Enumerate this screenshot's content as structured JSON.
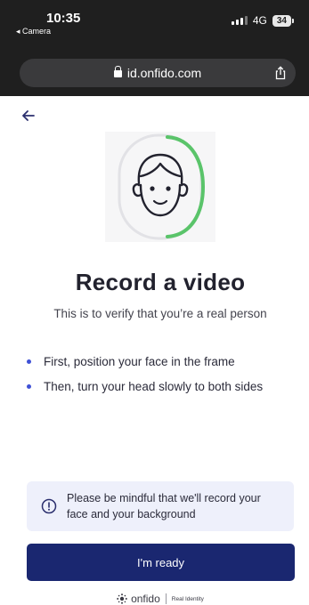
{
  "status_bar": {
    "time": "10:35",
    "back_app": "◂ Camera",
    "network": "4G",
    "battery": "34"
  },
  "browser": {
    "url": "id.onfido.com"
  },
  "icons": {
    "back": "arrow-left-icon",
    "lock": "lock-icon",
    "share": "share-icon",
    "face": "face-illustration-icon",
    "info": "info-icon",
    "onfido": "onfido-logo-icon"
  },
  "page": {
    "title": "Record a video",
    "subtitle": "This is to verify that you’re a real person",
    "steps": [
      "First, position your face in the frame",
      "Then, turn your head slowly to both sides"
    ],
    "notice_line1": "Please be mindful that we'll record your",
    "notice_line2": "face and your background",
    "button_label": "I'm ready"
  },
  "footer": {
    "brand": "onfido",
    "tagline": "Real Identity"
  },
  "colors": {
    "accent": "#1a2770",
    "bullet": "#3f51d6",
    "progress_green": "#5ac46a",
    "notice_bg": "#eef0fb"
  }
}
